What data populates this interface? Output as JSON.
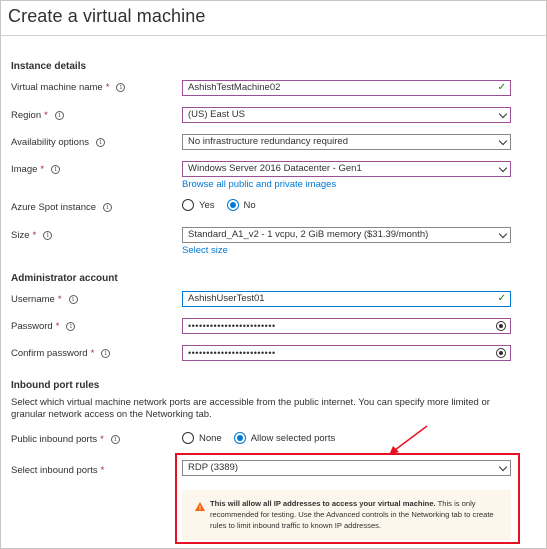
{
  "page": {
    "title": "Create a virtual machine"
  },
  "instance": {
    "heading": "Instance details",
    "vm_name": {
      "label": "Virtual machine name",
      "value": "AshishTestMachine02"
    },
    "region": {
      "label": "Region",
      "value": "(US) East US"
    },
    "availability": {
      "label": "Availability options",
      "value": "No infrastructure redundancy required"
    },
    "image": {
      "label": "Image",
      "value": "Windows Server 2016 Datacenter - Gen1",
      "link": "Browse all public and private images"
    },
    "spot": {
      "label": "Azure Spot instance",
      "yes": "Yes",
      "no": "No",
      "selected": "No"
    },
    "size": {
      "label": "Size",
      "value": "Standard_A1_v2 - 1 vcpu, 2 GiB memory ($31.39/month)",
      "link": "Select size"
    }
  },
  "admin": {
    "heading": "Administrator account",
    "username": {
      "label": "Username",
      "value": "AshishUserTest01"
    },
    "password": {
      "label": "Password",
      "value": "••••••••••••••••••••••••"
    },
    "confirm": {
      "label": "Confirm password",
      "value": "••••••••••••••••••••••••"
    }
  },
  "inbound": {
    "heading": "Inbound port rules",
    "description": "Select which virtual machine network ports are accessible from the public internet. You can specify more limited or granular network access on the Networking tab.",
    "public_ports": {
      "label": "Public inbound ports",
      "none": "None",
      "allow": "Allow selected ports",
      "selected": "Allow selected ports"
    },
    "select_ports": {
      "label": "Select inbound ports",
      "value": "RDP (3389)"
    },
    "warning": {
      "bold": "This will allow all IP addresses to access your virtual machine.",
      "text": " This is only recommended for testing.  Use the Advanced controls in the Networking tab to create rules to limit inbound traffic to known IP addresses."
    }
  },
  "colors": {
    "accent": "#0078d4",
    "required": "#a4262c",
    "highlight_border": "#e81123",
    "warning_bg": "#fdf6ec",
    "warning_icon": "#f7630c",
    "valid": "#107c10"
  },
  "icons": {
    "info": "info-icon",
    "check": "checkmark-icon",
    "chevron": "chevron-down-icon",
    "eye": "reveal-password-icon",
    "warning": "warning-icon"
  }
}
